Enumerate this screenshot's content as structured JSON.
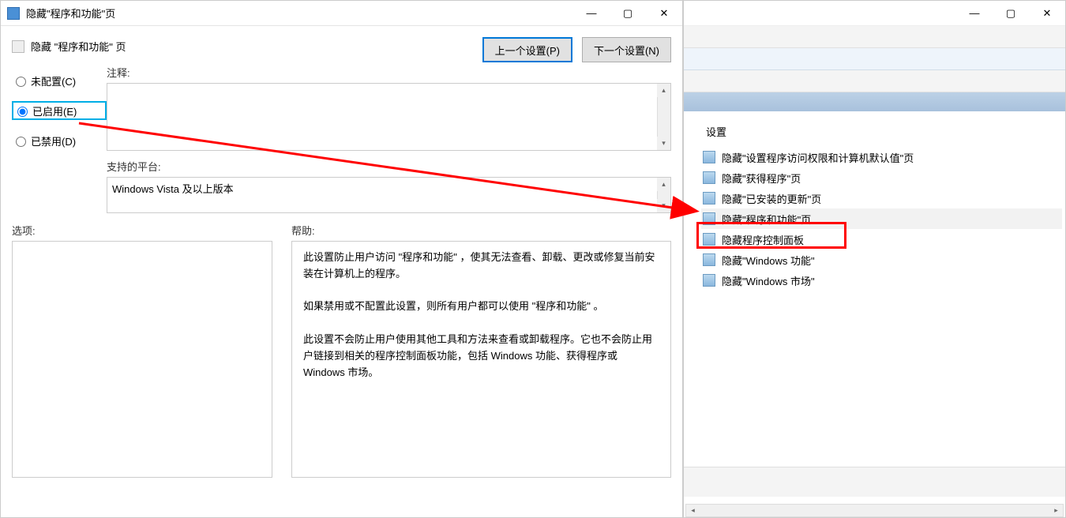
{
  "dialog": {
    "title": "隐藏\"程序和功能\"页",
    "policy_name": "隐藏 \"程序和功能\" 页",
    "prev_btn": "上一个设置(P)",
    "next_btn": "下一个设置(N)",
    "radios": {
      "not_configured": "未配置(C)",
      "enabled": "已启用(E)",
      "disabled": "已禁用(D)"
    },
    "comment_label": "注释:",
    "supported_label": "支持的平台:",
    "supported_text": "Windows Vista 及以上版本",
    "options_label": "选项:",
    "help_label": "帮助:",
    "help_p1": "此设置防止用户访问 \"程序和功能\" ，使其无法查看、卸载、更改或修复当前安装在计算机上的程序。",
    "help_p2": "如果禁用或不配置此设置，则所有用户都可以使用 \"程序和功能\" 。",
    "help_p3": "此设置不会防止用户使用其他工具和方法来查看或卸载程序。它也不会防止用户链接到相关的程序控制面板功能，包括 Windows 功能、获得程序或 Windows 市场。"
  },
  "list": {
    "group": "设置",
    "items": [
      "隐藏\"设置程序访问权限和计算机默认值\"页",
      "隐藏\"获得程序\"页",
      "隐藏\"已安装的更新\"页",
      "隐藏\"程序和功能\"页",
      "隐藏程序控制面板",
      "隐藏\"Windows 功能\"",
      "隐藏\"Windows 市场\""
    ]
  }
}
